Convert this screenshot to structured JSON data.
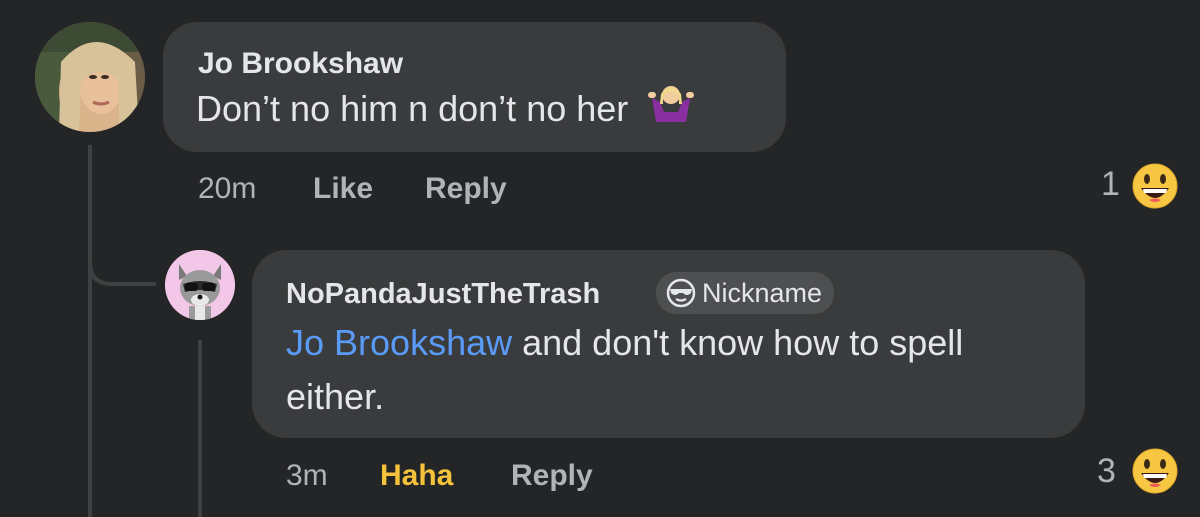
{
  "comments": [
    {
      "author": "Jo Brookshaw",
      "text": "Don’t no him n don’t no her",
      "emoji_icon": "woman-shrugging-icon",
      "time": "20m",
      "actions": {
        "like": "Like",
        "reply": "Reply"
      },
      "reaction": {
        "count": "1",
        "icon": "grinning-face-icon"
      }
    },
    {
      "author": "NoPandaJustTheTrash",
      "badge": {
        "icon": "sunglasses-face-icon",
        "label": "Nickname"
      },
      "mention": "Jo Brookshaw",
      "text_line1": " and don't know how to spell",
      "text_line2": "either.",
      "time": "3m",
      "actions": {
        "haha": "Haha",
        "reply": "Reply"
      },
      "reaction": {
        "count": "3",
        "icon": "grinning-face-icon"
      }
    }
  ],
  "colors": {
    "background": "#242526",
    "bubble": "#3a3b3c",
    "mention": "#5b9bf8",
    "haha_active": "#f5c33b",
    "secondary_text": "#b0b3b8"
  }
}
